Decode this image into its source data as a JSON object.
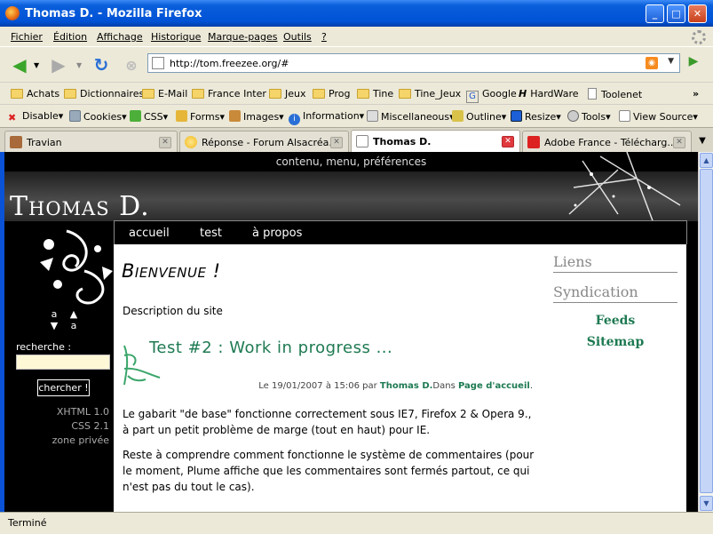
{
  "window": {
    "title": "Thomas D. - Mozilla Firefox",
    "buttons": {
      "minimize": "_",
      "maximize": "□",
      "close": "✕"
    }
  },
  "menu": [
    "Fichier",
    "Édition",
    "Affichage",
    "Historique",
    "Marque-pages",
    "Outils",
    "?"
  ],
  "nav": {
    "url": "http://tom.freezee.org/#"
  },
  "bookmarks": [
    "Achats",
    "Dictionnaires",
    "E-Mail",
    "France Inter",
    "Jeux",
    "Prog",
    "Tine",
    "Tine_Jeux",
    "Google",
    "HardWare",
    "Toolenet"
  ],
  "devbar": [
    "Disable▾",
    "Cookies▾",
    "CSS▾",
    "Forms▾",
    "Images▾",
    "Information▾",
    "Miscellaneous▾",
    "Outline▾",
    "Resize▾",
    "Tools▾",
    "View Source▾"
  ],
  "tabs": [
    {
      "label": "Travian",
      "active": false
    },
    {
      "label": "Réponse - Forum Alsacréa...",
      "active": false
    },
    {
      "label": "Thomas D.",
      "active": true
    },
    {
      "label": "Adobe France - Télécharg...",
      "active": false
    }
  ],
  "status": "Terminé",
  "site": {
    "top_links": "contenu, menu, préférences",
    "title": "Thomas D.",
    "font_small": "a",
    "font_large": "a",
    "search_label": "recherche :",
    "search_button": "chercher !",
    "side_links": [
      "XHTML 1.0",
      "CSS 2.1",
      "zone privée"
    ],
    "menu": [
      "accueil",
      "test",
      "à propos"
    ],
    "heading": "Bienvenue !",
    "description": "Description du site",
    "post": {
      "title": "Test #2 : Work in progress ...",
      "meta_prefix": "Le 19/01/2007 à 15:06 par",
      "author": "Thomas D.",
      "meta_mid": "Dans",
      "category": "Page d'accueil",
      "meta_suffix": ".",
      "p1": "Le gabarit \"de base\" fonctionne correctement sous IE7, Firefox 2 & Opera 9., à part un petit problème de marge (tout en haut) pour IE.",
      "p2": "Reste à comprendre comment fonctionne le système de commentaires (pour le moment, Plume affiche que les commentaires sont fermés partout, ce qui n'est pas du tout le cas)."
    },
    "sidebar": {
      "links_heading": "Liens",
      "syndication_heading": "Syndication",
      "feeds": "Feeds",
      "sitemap": "Sitemap"
    }
  }
}
